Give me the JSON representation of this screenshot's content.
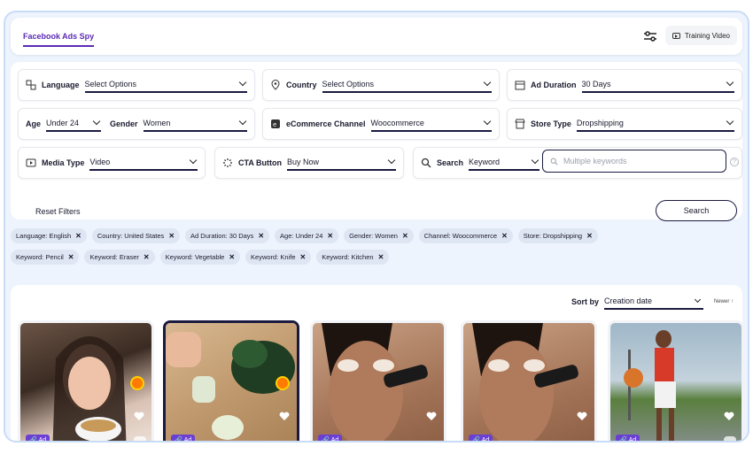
{
  "header": {
    "tab": "Facebook Ads Spy",
    "training": "Training Video"
  },
  "filters": {
    "language": {
      "label": "Language",
      "value": "Select Options"
    },
    "country": {
      "label": "Country",
      "value": "Select Options"
    },
    "ad_duration": {
      "label": "Ad Duration",
      "value": "30 Days"
    },
    "age": {
      "label": "Age",
      "value": "Under 24"
    },
    "gender": {
      "label": "Gender",
      "value": "Women"
    },
    "ecommerce": {
      "label": "eCommerce Channel",
      "value": "Woocommerce"
    },
    "store_type": {
      "label": "Store Type",
      "value": "Dropshipping"
    },
    "media_type": {
      "label": "Media Type",
      "value": "Video"
    },
    "cta": {
      "label": "CTA Button",
      "value": "Buy Now"
    },
    "search": {
      "label": "Search",
      "value": "Keyword",
      "placeholder": "Multiple keywords"
    },
    "reset": "Reset Filters",
    "search_button": "Search"
  },
  "chips": [
    "Language: English",
    "Country: United States",
    "Ad Duration: 30 Days",
    "Age: Under 24",
    "Gender: Women",
    "Channel: Woocommerce",
    "Store: Dropshipping",
    "Keyword: Pencil",
    "Keyword: Eraser",
    "Keyword: Vegetable",
    "Keyword: Knife",
    "Keyword: Kitchen"
  ],
  "sort": {
    "label": "Sort by",
    "value": "Creation date",
    "order": "Newer ↑"
  },
  "cards": [
    {
      "badge": "Ad"
    },
    {
      "badge": "Ad"
    },
    {
      "badge": "Ad"
    },
    {
      "badge": "Ad"
    },
    {
      "badge": "Ad"
    }
  ],
  "colors": {
    "accent": "#5b2bb5",
    "badge": "#6b3fd3",
    "chip_bg": "#dfe6f3",
    "frame": "#c9dcf7"
  }
}
